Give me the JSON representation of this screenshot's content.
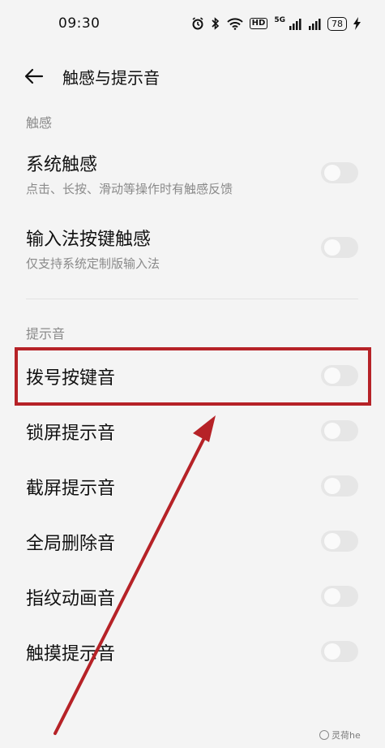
{
  "status_bar": {
    "time": "09:30",
    "hd_label": "HD",
    "network_label": "5G",
    "battery": "78"
  },
  "header": {
    "title": "触感与提示音"
  },
  "sections": {
    "haptics": "触感",
    "sounds": "提示音"
  },
  "rows": [
    {
      "title": "系统触感",
      "subtitle": "点击、长按、滑动等操作时有触感反馈",
      "on": false
    },
    {
      "title": "输入法按键触感",
      "subtitle": "仅支持系统定制版输入法",
      "on": false
    },
    {
      "title": "拨号按键音",
      "on": false
    },
    {
      "title": "锁屏提示音",
      "on": false
    },
    {
      "title": "截屏提示音",
      "on": false
    },
    {
      "title": "全局删除音",
      "on": false
    },
    {
      "title": "指纹动画音",
      "on": false
    },
    {
      "title": "触摸提示音",
      "on": false
    }
  ],
  "annotation": {
    "highlight_color": "#b62227",
    "arrow_color": "#b62227"
  },
  "watermark": {
    "text": "灵荷he"
  }
}
